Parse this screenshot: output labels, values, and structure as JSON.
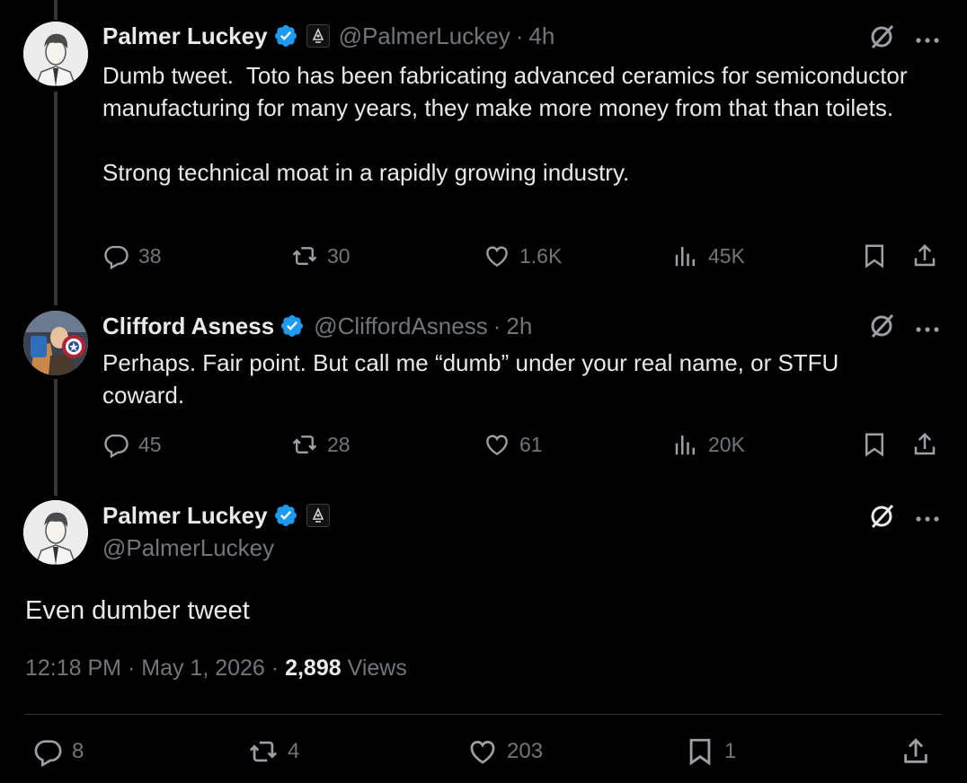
{
  "tweet1": {
    "name": "Palmer Luckey",
    "handle": "@PalmerLuckey",
    "dot": "·",
    "time": "4h",
    "text": "Dumb tweet.  Toto has been fabricating advanced ceramics for semiconductor manufacturing for many years, they make more money from that than toilets.\n\nStrong technical moat in a rapidly growing industry.",
    "replies": "38",
    "reposts": "30",
    "likes": "1.6K",
    "views": "45K"
  },
  "tweet2": {
    "name": "Clifford Asness",
    "handle": "@CliffordAsness",
    "dot": "·",
    "time": "2h",
    "text": "Perhaps. Fair point. But call me “dumb” under your real name, or STFU coward.",
    "replies": "45",
    "reposts": "28",
    "likes": "61",
    "views": "20K"
  },
  "main": {
    "name": "Palmer Luckey",
    "handle": "@PalmerLuckey",
    "text": "Even dumber tweet",
    "time": "12:18 PM",
    "sep1": "·",
    "date": "May 1, 2026",
    "sep2": "·",
    "views_count": "2,898",
    "views_label": "Views",
    "replies": "8",
    "reposts": "4",
    "likes": "203",
    "bookmarks": "1"
  },
  "colors": {
    "background": "#000000",
    "primary_text": "#e7e9ea",
    "secondary_text": "#71767b",
    "verified": "#1d9bf0",
    "divider": "#2f3336"
  },
  "icons": [
    "verified-badge-icon",
    "affiliate-badge-icon",
    "grok-icon",
    "more-icon",
    "reply-icon",
    "repost-icon",
    "like-icon",
    "views-icon",
    "bookmark-icon",
    "share-icon"
  ]
}
